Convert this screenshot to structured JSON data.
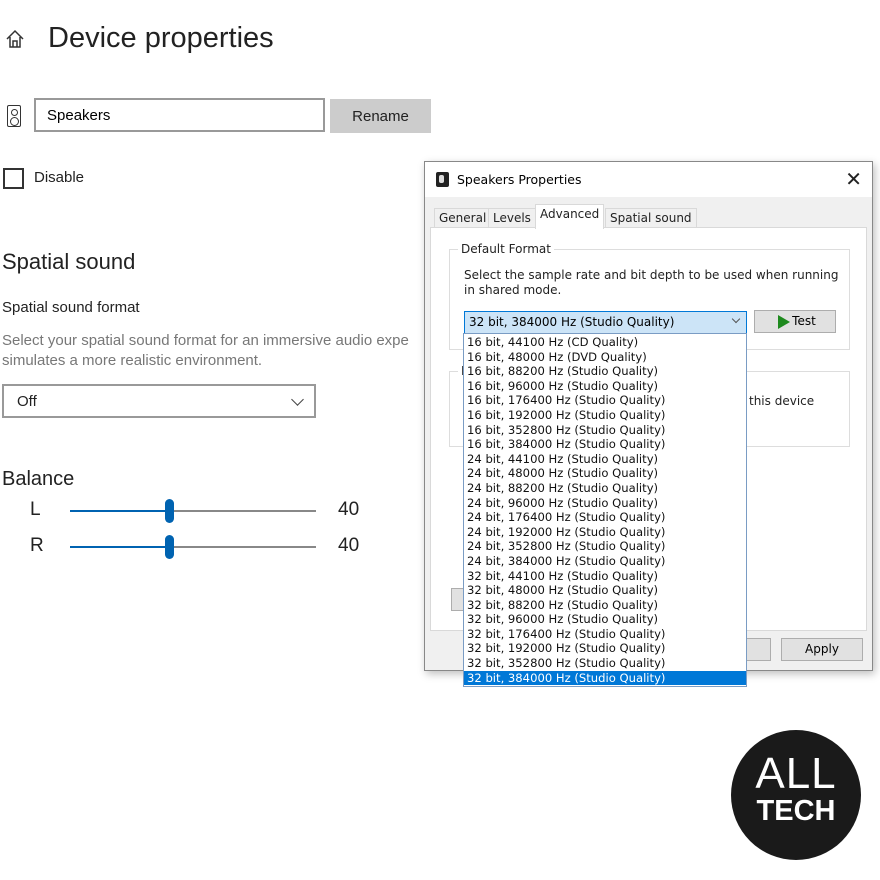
{
  "page": {
    "title": "Device properties",
    "icon": "home-icon"
  },
  "device": {
    "icon": "speaker-icon",
    "name": "Speakers",
    "rename_label": "Rename",
    "disable_label": "Disable",
    "disabled": false
  },
  "spatial": {
    "heading": "Spatial sound",
    "format_label": "Spatial sound format",
    "description_line1": "Select your spatial sound format for an immersive audio expe",
    "description_line2": "simulates a more realistic environment.",
    "format_value": "Off"
  },
  "balance": {
    "heading": "Balance",
    "left_label": "L",
    "right_label": "R",
    "left_value": "40",
    "right_value": "40",
    "accent": "#0063b1"
  },
  "dialog": {
    "title": "Speakers Properties",
    "tabs": [
      {
        "label": "General"
      },
      {
        "label": "Levels"
      },
      {
        "label": "Advanced",
        "active": true
      },
      {
        "label": "Spatial sound"
      }
    ],
    "default_format": {
      "group_label": "Default Format",
      "description": "Select the sample rate and bit depth to be used when running in shared mode.",
      "selected": "32 bit, 384000 Hz (Studio Quality)",
      "test_label": "Test"
    },
    "hidden_group": {
      "label_fragment": "E",
      "text_fragment": "this device"
    },
    "options": [
      "16 bit, 44100 Hz (CD Quality)",
      "16 bit, 48000 Hz (DVD Quality)",
      "16 bit, 88200 Hz (Studio Quality)",
      "16 bit, 96000 Hz (Studio Quality)",
      "16 bit, 176400 Hz (Studio Quality)",
      "16 bit, 192000 Hz (Studio Quality)",
      "16 bit, 352800 Hz (Studio Quality)",
      "16 bit, 384000 Hz (Studio Quality)",
      "24 bit, 44100 Hz (Studio Quality)",
      "24 bit, 48000 Hz (Studio Quality)",
      "24 bit, 88200 Hz (Studio Quality)",
      "24 bit, 96000 Hz (Studio Quality)",
      "24 bit, 176400 Hz (Studio Quality)",
      "24 bit, 192000 Hz (Studio Quality)",
      "24 bit, 352800 Hz (Studio Quality)",
      "24 bit, 384000 Hz (Studio Quality)",
      "32 bit, 44100 Hz (Studio Quality)",
      "32 bit, 48000 Hz (Studio Quality)",
      "32 bit, 88200 Hz (Studio Quality)",
      "32 bit, 96000 Hz (Studio Quality)",
      "32 bit, 176400 Hz (Studio Quality)",
      "32 bit, 192000 Hz (Studio Quality)",
      "32 bit, 352800 Hz (Studio Quality)",
      "32 bit, 384000 Hz (Studio Quality)"
    ],
    "selected_index": 23,
    "apply_label": "Apply",
    "highlight_color": "#0078d7"
  },
  "watermark": {
    "line1": "ALL",
    "line2": "TECH"
  }
}
